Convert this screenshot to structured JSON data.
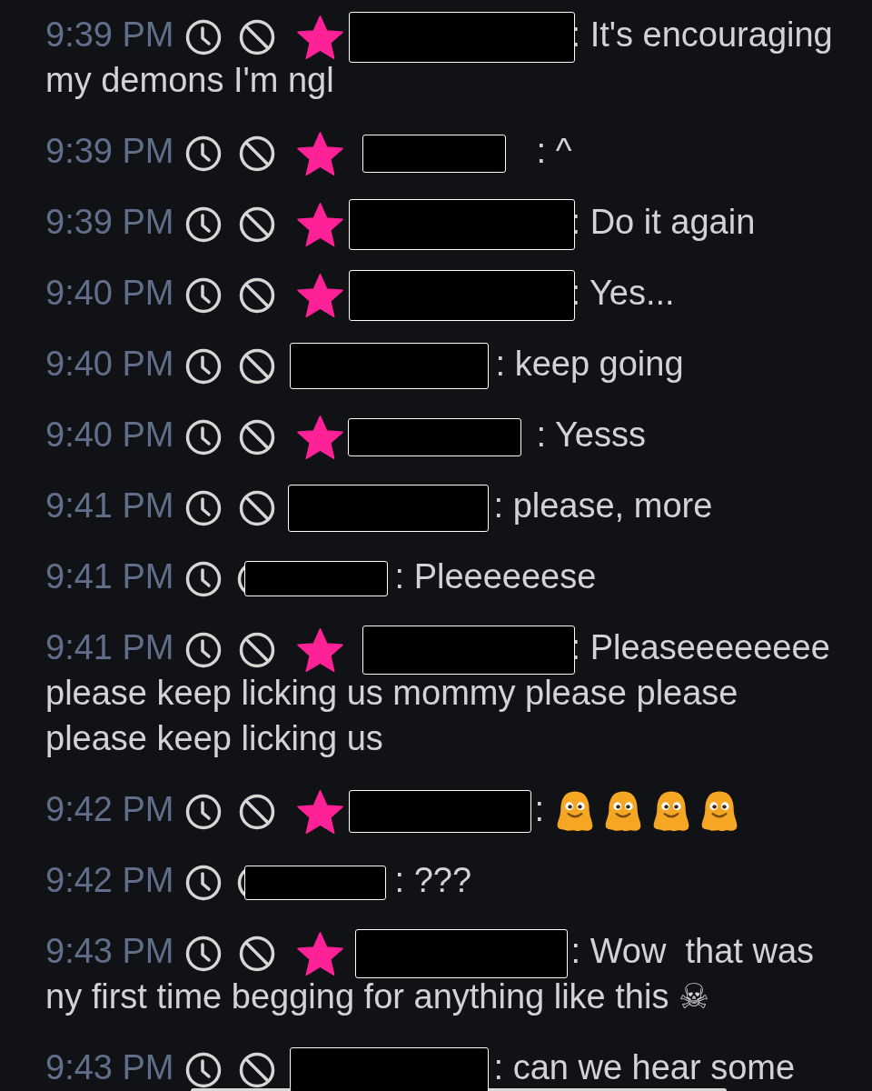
{
  "messages": [
    {
      "time": "9:39 PM",
      "star_badge": true,
      "parts": [
        {
          "kind": "text",
          "text": ": It's encouraging"
        },
        {
          "kind": "continuation",
          "text": "my demons I'm ngl"
        }
      ]
    },
    {
      "time": "9:39 PM",
      "star_badge": true,
      "parts": [
        {
          "kind": "text",
          "text": ": ^"
        }
      ]
    },
    {
      "time": "9:39 PM",
      "star_badge": true,
      "parts": [
        {
          "kind": "text",
          "text": ": Do it again"
        }
      ]
    },
    {
      "time": "9:40 PM",
      "star_badge": true,
      "parts": [
        {
          "kind": "text",
          "text": ": Yes..."
        }
      ]
    },
    {
      "time": "9:40 PM",
      "star_badge": false,
      "parts": [
        {
          "kind": "text",
          "text": ": keep going"
        }
      ]
    },
    {
      "time": "9:40 PM",
      "star_badge": true,
      "parts": [
        {
          "kind": "text",
          "text": ": Yesss"
        }
      ]
    },
    {
      "time": "9:41 PM",
      "star_badge": false,
      "parts": [
        {
          "kind": "text",
          "text": ": please, more"
        }
      ]
    },
    {
      "time": "9:41 PM",
      "star_badge": false,
      "parts": [
        {
          "kind": "text",
          "text": ": Pleeeeeese"
        }
      ]
    },
    {
      "time": "9:41 PM",
      "star_badge": true,
      "parts": [
        {
          "kind": "text",
          "text": ": Pleaseeeeeeee"
        },
        {
          "kind": "continuation",
          "text": "please keep licking us mommy please please"
        },
        {
          "kind": "continuation",
          "text": "please keep licking us"
        }
      ]
    },
    {
      "time": "9:42 PM",
      "star_badge": true,
      "parts": [
        {
          "kind": "text",
          "text": ":"
        },
        {
          "kind": "emote"
        },
        {
          "kind": "emote"
        },
        {
          "kind": "emote"
        },
        {
          "kind": "emote"
        }
      ]
    },
    {
      "time": "9:42 PM",
      "star_badge": false,
      "parts": [
        {
          "kind": "text",
          "text": ": ???"
        }
      ]
    },
    {
      "time": "9:43 PM",
      "star_badge": true,
      "parts": [
        {
          "kind": "text",
          "text": ": Wow  that was"
        },
        {
          "kind": "continuation",
          "text": "ny first time begging for anything like this ☠"
        }
      ]
    },
    {
      "time": "9:43 PM",
      "star_badge": false,
      "parts": [
        {
          "kind": "text",
          "text": ": can we hear some"
        }
      ]
    }
  ]
}
